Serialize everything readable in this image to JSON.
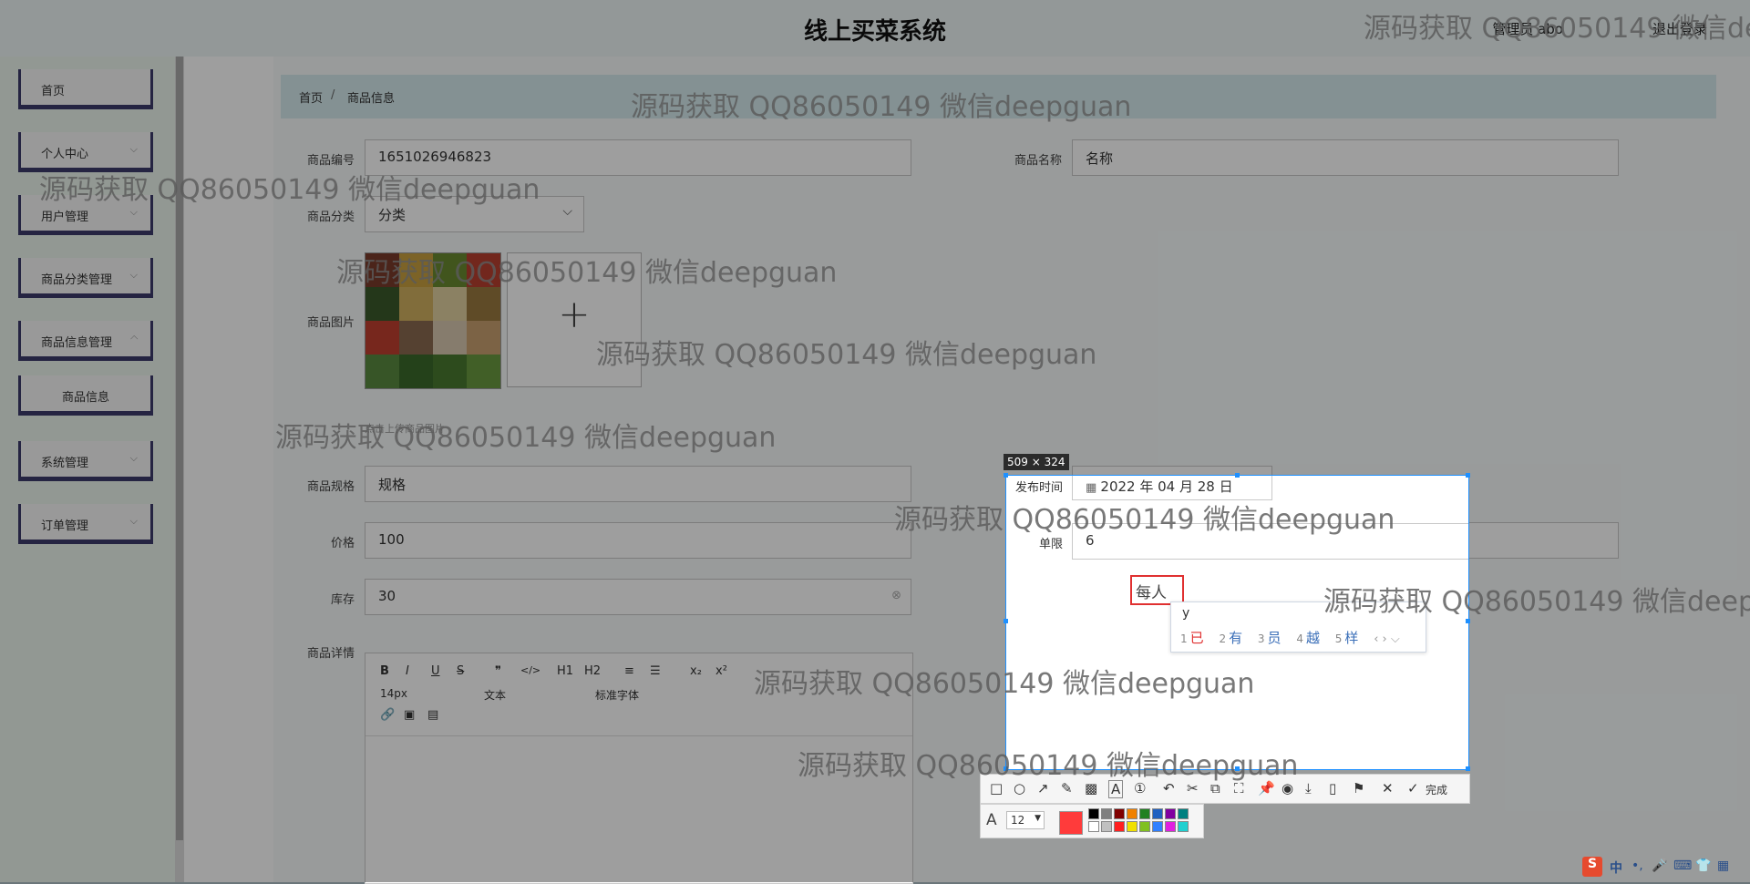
{
  "header": {
    "title": "线上买菜系统",
    "user": "管理员 abo",
    "logout": "退出登录"
  },
  "sidebar": {
    "items": [
      {
        "label": "首页",
        "has_children": false
      },
      {
        "label": "个人中心",
        "has_children": true
      },
      {
        "label": "用户管理",
        "has_children": true
      },
      {
        "label": "商品分类管理",
        "has_children": true
      },
      {
        "label": "商品信息管理",
        "has_children": true
      },
      {
        "label": "商品信息",
        "has_children": false,
        "sub": true
      },
      {
        "label": "系统管理",
        "has_children": true
      },
      {
        "label": "订单管理",
        "has_children": true
      }
    ],
    "chevron": "⌵"
  },
  "breadcrumb": {
    "home": "首页",
    "sep": "/",
    "current": "商品信息"
  },
  "form": {
    "code_label": "商品编号",
    "code_value": "1651026946823",
    "name_label": "商品名称",
    "name_value": "名称",
    "category_label": "商品分类",
    "category_value": "分类",
    "image_label": "商品图片",
    "upload_tip": "点击上传商品图片",
    "spec_label": "商品规格",
    "spec_value": "规格",
    "price_label": "价格",
    "price_value": "100",
    "stock_label": "库存",
    "stock_value": "30",
    "detail_label": "商品详情",
    "publish_label": "发布时间",
    "publish_value": "2022 年 04 月 28 日",
    "limit_label": "单限",
    "limit_value": "6"
  },
  "editor": {
    "row1": [
      "B",
      "I",
      "U",
      "S",
      "❞",
      "</>",
      "H1",
      "H2",
      "≡",
      "☰",
      "x₂",
      "x²"
    ],
    "font_size": "14px",
    "text_type": "文本",
    "font_family": "标准字体",
    "icons": [
      "link-icon",
      "image-icon",
      "video-icon"
    ]
  },
  "capture": {
    "size": "509 × 324",
    "text": "每人",
    "ime_input": "y",
    "candidates": [
      {
        "n": "1",
        "c": "已"
      },
      {
        "n": "2",
        "c": "有"
      },
      {
        "n": "3",
        "c": "员"
      },
      {
        "n": "4",
        "c": "越"
      },
      {
        "n": "5",
        "c": "样"
      }
    ],
    "finish": "完成",
    "font_size": "12",
    "accent": "#ff3b3b",
    "palette": [
      "#000000",
      "#808080",
      "#800000",
      "#f08000",
      "#208020",
      "#2060c0",
      "#8000a0",
      "#008080",
      "#ffffff",
      "#c0c0c0",
      "#ff2020",
      "#f0e000",
      "#80c020",
      "#3080ff",
      "#e020e0",
      "#20d0d0"
    ]
  },
  "watermark": "源码获取 QQ86050149 微信deepguan",
  "tray": {
    "ime": "中"
  }
}
